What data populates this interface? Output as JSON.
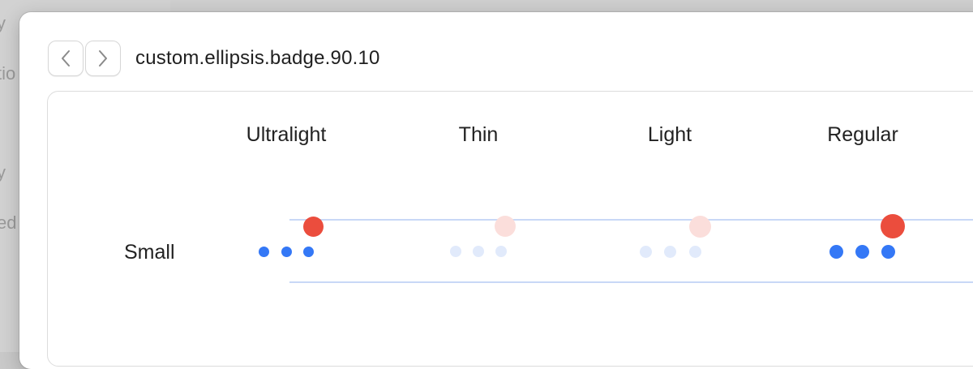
{
  "window": {
    "title": "custom.ellipsis.badge.90.10"
  },
  "background_fragments": [
    "y",
    "tio",
    "y",
    "ed"
  ],
  "nav": {
    "back_icon": "chevron-left-icon",
    "forward_icon": "chevron-right-icon"
  },
  "grid": {
    "columns": [
      "Ultralight",
      "Thin",
      "Light",
      "Regular"
    ],
    "rows": [
      "Small"
    ]
  },
  "symbols": [
    {
      "weight": "Ultralight",
      "state": "active",
      "badge_color": "#eb4d3d",
      "dot_color": "#3478f6"
    },
    {
      "weight": "Thin",
      "state": "dimmed",
      "badge_color": "#fbdedb",
      "dot_color": "#e1eafb"
    },
    {
      "weight": "Light",
      "state": "dimmed",
      "badge_color": "#fbdedb",
      "dot_color": "#e1eafb"
    },
    {
      "weight": "Regular",
      "state": "active",
      "badge_color": "#eb4d3d",
      "dot_color": "#3478f6"
    }
  ],
  "colors": {
    "guide_line": "#c8d8f6",
    "accent_blue": "#3478f6",
    "badge_red": "#eb4d3d"
  }
}
